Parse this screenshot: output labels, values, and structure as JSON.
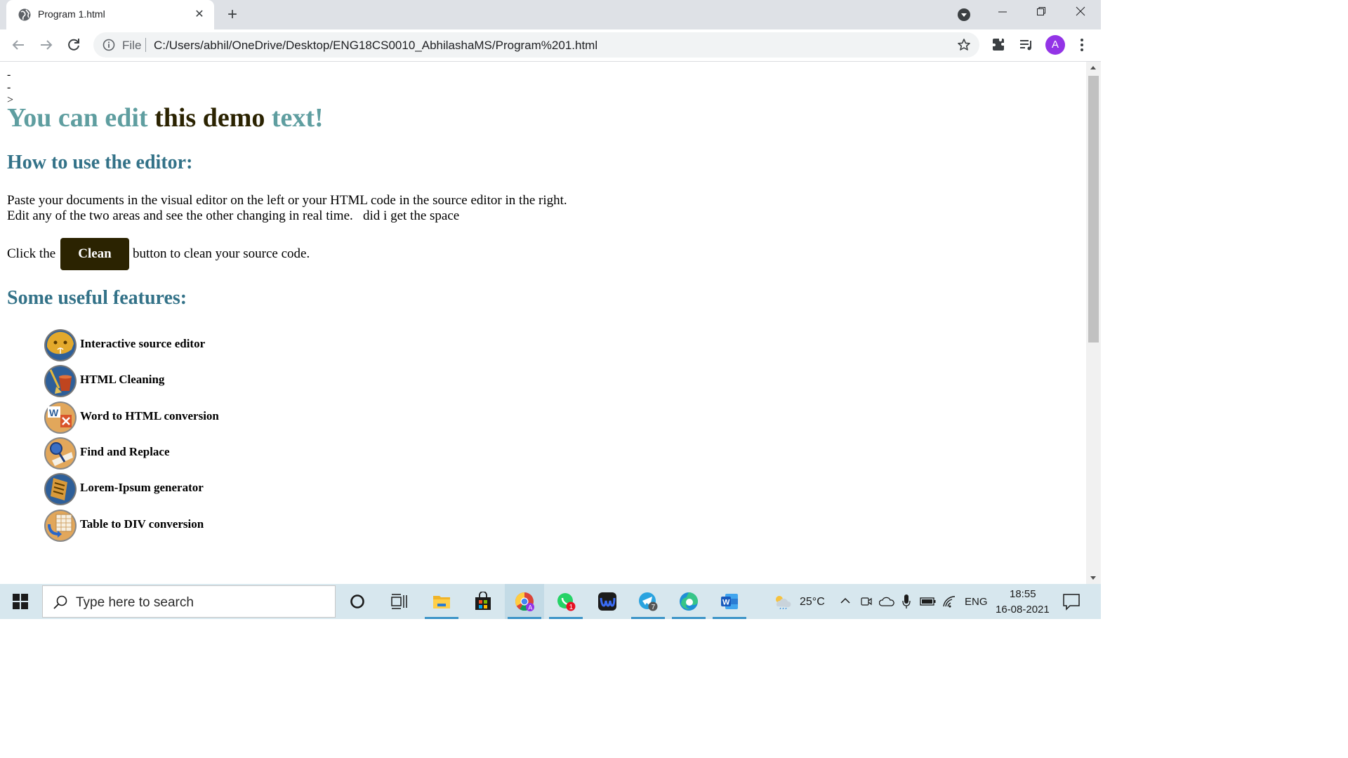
{
  "browser": {
    "tab_title": "Program 1.html",
    "address_scheme": "File",
    "address_url": "C:/Users/abhil/OneDrive/Desktop/ENG18CS0010_AbhilashaMS/Program%201.html",
    "profile_initial": "A"
  },
  "page": {
    "stray_text": "-->",
    "heading": {
      "part1": "You can edit ",
      "part2": "this demo",
      "part3": " text!"
    },
    "section1_title": "How to use the editor:",
    "paragraph_line1": "Paste your documents in the visual editor on the left or your HTML code in the source editor in the right.",
    "paragraph_line2": "Edit any of the two areas and see the other changing in real time.   did i get the space",
    "click_prefix": "Click the",
    "clean_button": "Clean",
    "click_suffix": "button to clean your source code.",
    "section2_title": "Some useful features:",
    "features": [
      {
        "label": "Interactive source editor",
        "icon": "source-editor-icon"
      },
      {
        "label": "HTML Cleaning",
        "icon": "html-cleaning-icon"
      },
      {
        "label": "Word to HTML conversion",
        "icon": "word-conversion-icon"
      },
      {
        "label": "Find and Replace",
        "icon": "find-replace-icon"
      },
      {
        "label": "Lorem-Ipsum generator",
        "icon": "lorem-ipsum-icon"
      },
      {
        "label": "Table to DIV conversion",
        "icon": "table-div-icon"
      }
    ]
  },
  "taskbar": {
    "search_placeholder": "Type here to search",
    "weather": "25°C",
    "language": "ENG",
    "time": "18:55",
    "date": "16-08-2021",
    "whatsapp_badge": "1",
    "telegram_badge": "7"
  },
  "colors": {
    "heading_teal": "#5f9ea0",
    "heading_dark": "#2b2301",
    "section_blue": "#337288",
    "clean_button_bg": "#2b2301"
  }
}
